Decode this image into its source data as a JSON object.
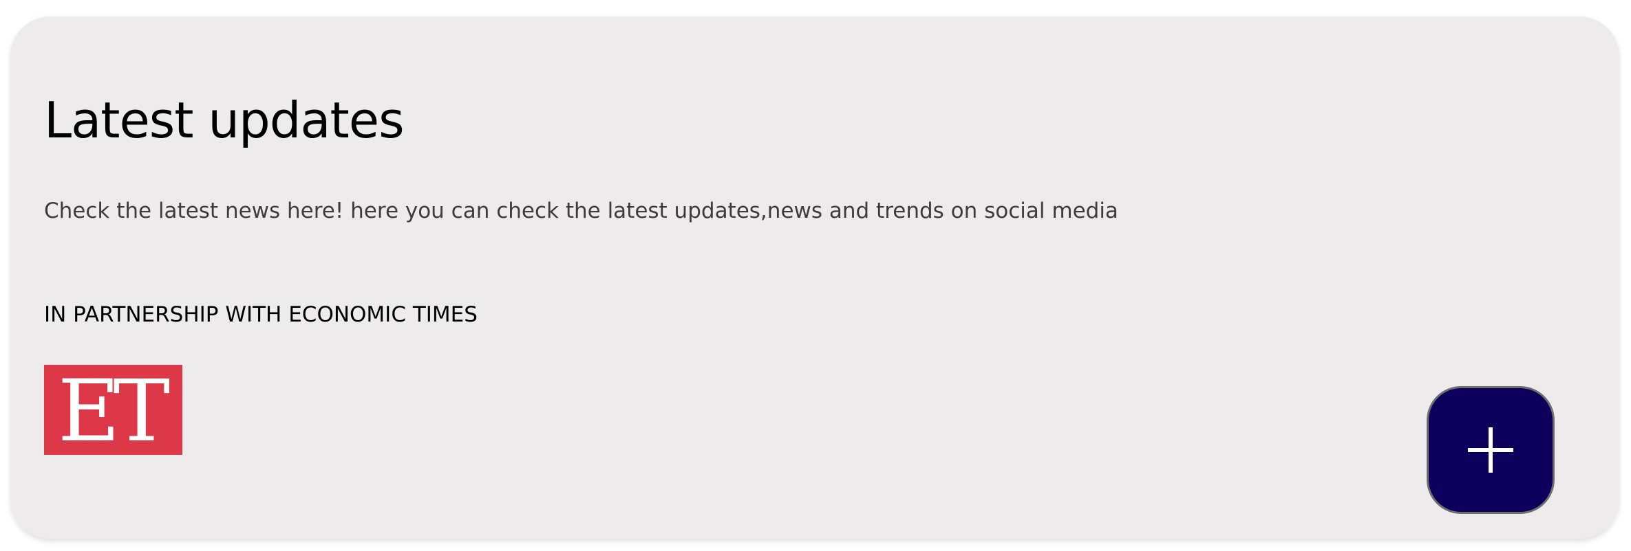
{
  "card": {
    "title": "Latest updates",
    "description": "Check the latest news here! here you can check the latest updates,news and trends on social media",
    "partnership": "IN PARTNERSHIP WITH ECONOMIC TIMES",
    "logo": {
      "text": "ET",
      "background": "#dd3848"
    }
  },
  "fab": {
    "icon": "plus-icon",
    "background": "#0c005c"
  },
  "colors": {
    "card_background": "#edebec",
    "title": "#000000",
    "description": "#3c3c3c"
  }
}
